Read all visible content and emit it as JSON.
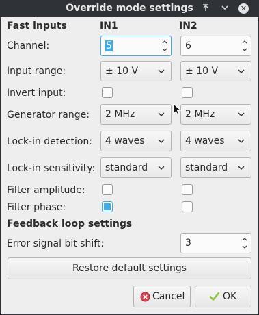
{
  "window": {
    "title": "Override mode settings"
  },
  "sections": {
    "fast_inputs": "Fast inputs",
    "feedback": "Feedback loop settings"
  },
  "columns": {
    "in1": "IN1",
    "in2": "IN2"
  },
  "rows": {
    "channel": {
      "label": "Channel:",
      "in1": "5",
      "in2": "6"
    },
    "input_range": {
      "label": "Input range:",
      "in1": "± 10 V",
      "in2": "± 10 V"
    },
    "invert_input": {
      "label": "Invert input:",
      "in1": false,
      "in2": false
    },
    "generator_range": {
      "label": "Generator range:",
      "in1": "2 MHz",
      "in2": "2 MHz"
    },
    "lockin_detection": {
      "label": "Lock-in detection:",
      "in1": "4 waves",
      "in2": "4 waves"
    },
    "lockin_sensitivity": {
      "label": "Lock-in sensitivity:",
      "in1": "standard",
      "in2": "standard"
    },
    "filter_amplitude": {
      "label": "Filter amplitude:",
      "in1": false,
      "in2": false
    },
    "filter_phase": {
      "label": "Filter phase:",
      "in1": true,
      "in2": false
    }
  },
  "error_shift": {
    "label": "Error signal bit shift:",
    "value": "3"
  },
  "buttons": {
    "restore": "Restore default settings",
    "cancel": "Cancel",
    "ok": "OK"
  },
  "icons": {
    "titlebar": [
      "pin-icon",
      "minimize-icon",
      "close-icon"
    ],
    "cancel": "cancel-icon",
    "ok": "checkmark-icon"
  },
  "colors": {
    "accent": "#3daee9",
    "titlebar": "#2f3338",
    "background": "#eeeeee"
  }
}
